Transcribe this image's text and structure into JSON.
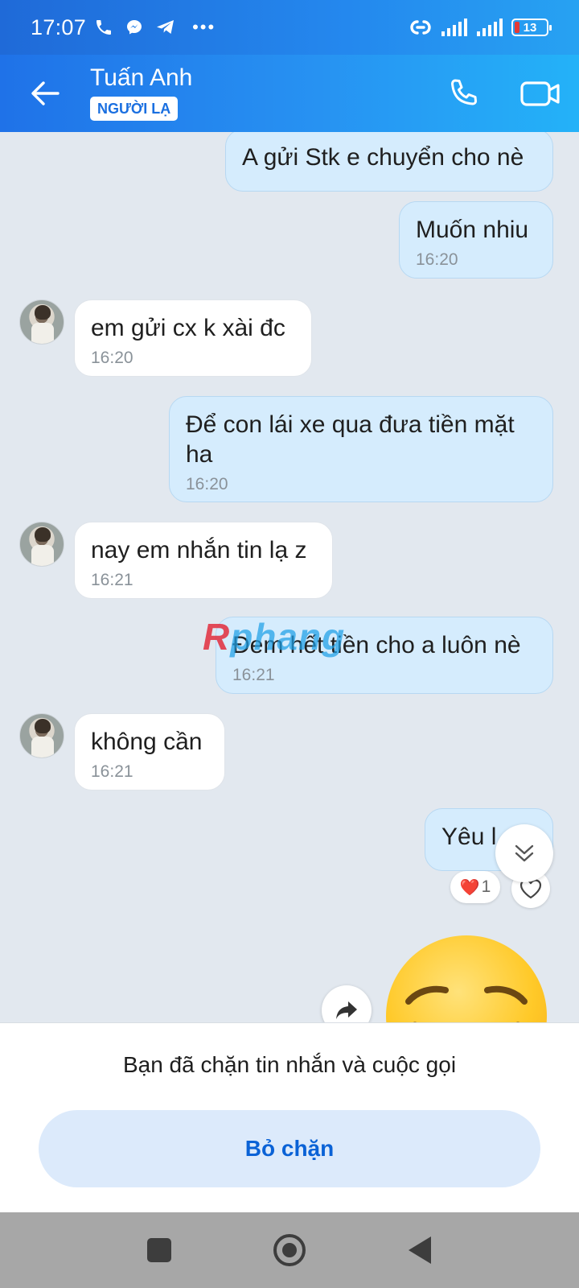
{
  "status_bar": {
    "time": "17:07",
    "battery_level": "13"
  },
  "header": {
    "contact_name": "Tuấn Anh",
    "badge": "NGƯỜI LẠ"
  },
  "messages": [
    {
      "direction": "out",
      "text": "A gửi Stk e chuyển cho nè",
      "time": ""
    },
    {
      "direction": "out",
      "text": "Muốn nhiu",
      "time": "16:20"
    },
    {
      "direction": "in",
      "text": "em gửi cx k xài đc",
      "time": "16:20"
    },
    {
      "direction": "out",
      "text": "Để con lái xe qua đưa tiền mặt ha",
      "time": "16:20"
    },
    {
      "direction": "in",
      "text": "nay em nhắn tin lạ z",
      "time": "16:21"
    },
    {
      "direction": "out",
      "text": "Đem hết tiền cho a luôn nè",
      "time": "16:21"
    },
    {
      "direction": "in",
      "text": "không cần",
      "time": "16:21"
    },
    {
      "direction": "out",
      "text": "Yêu l",
      "time": ""
    }
  ],
  "reaction": {
    "emoji": "❤️",
    "count": "1"
  },
  "watermark": {
    "part1": "R",
    "part2": "phang"
  },
  "block_panel": {
    "notice": "Bạn đã chặn tin nhắn và cuộc gọi",
    "unblock_label": "Bỏ chặn"
  }
}
